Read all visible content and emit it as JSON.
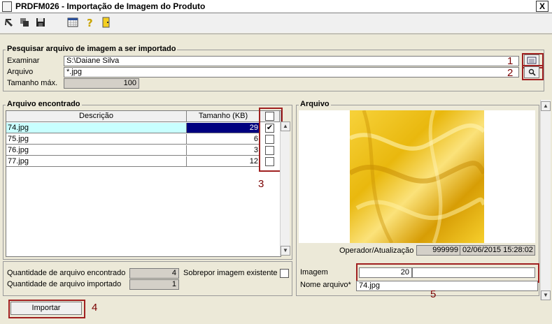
{
  "window": {
    "title": "PRDFM026 - Importação de Imagem do Produto",
    "close_label": "X"
  },
  "toolbar": {
    "icons": [
      "arrow-icon",
      "copy-icon",
      "save-icon",
      "calendar-icon",
      "help-icon",
      "exit-door-icon"
    ]
  },
  "search_group": {
    "title": "Pesquisar arquivo de imagem a ser importado",
    "examinar_label": "Examinar",
    "examinar_value": "S:\\Daiane Silva",
    "arquivo_label": "Arquivo",
    "arquivo_value": "*.jpg",
    "tamanho_label": "Tamanho máx.",
    "tamanho_value": "100",
    "annot1": "1",
    "annot2": "2"
  },
  "found_group": {
    "title": "Arquivo encontrado",
    "col_descricao": "Descrição",
    "col_tamanho": "Tamanho (KB)",
    "rows": [
      {
        "descricao": "74.jpg",
        "tamanho": "29",
        "checked": true,
        "selected": true
      },
      {
        "descricao": "75.jpg",
        "tamanho": "6",
        "checked": false,
        "selected": false
      },
      {
        "descricao": "76.jpg",
        "tamanho": "3",
        "checked": false,
        "selected": false
      },
      {
        "descricao": "77.jpg",
        "tamanho": "12",
        "checked": false,
        "selected": false
      }
    ],
    "annot3": "3"
  },
  "summary": {
    "qtd_encontrado_label": "Quantidade de arquivo encontrado",
    "qtd_encontrado_value": "4",
    "qtd_importado_label": "Quantidade de arquivo importado",
    "qtd_importado_value": "1",
    "sobrepor_label": "Sobrepor imagem existente"
  },
  "actions": {
    "importar_label": "Importar",
    "annot4": "4"
  },
  "arquivo_group": {
    "title": "Arquivo",
    "operador_label": "Operador/Atualização",
    "operador_value": "999999",
    "data_value": "02/06/2015 15:28:02",
    "imagem_label": "Imagem",
    "imagem_value": "20",
    "imagem_desc": "",
    "nome_label": "Nome arquivo*",
    "nome_value": "74.jpg",
    "annot5": "5"
  },
  "colors": {
    "accent_red": "#a02020",
    "selection": "#00007f",
    "row_highlight": "#c8ffff",
    "image_gold": "#f1c419"
  }
}
